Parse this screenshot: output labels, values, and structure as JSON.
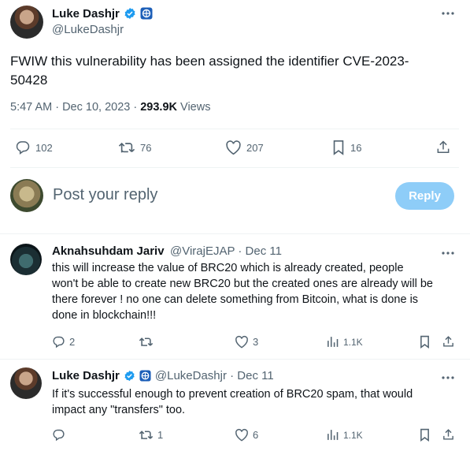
{
  "main_tweet": {
    "author_name": "Luke Dashjr",
    "author_handle": "@LukeDashjr",
    "text_line1": "FWIW this vulnerability has been assigned the identifier CVE-2023-",
    "text_line2": "50428",
    "time": "5:47 AM · Dec 10, 2023 · ",
    "views_count": "293.9K",
    "views_label": " Views",
    "replies": "102",
    "retweets": "76",
    "likes": "207",
    "bookmarks": "16"
  },
  "composer": {
    "placeholder": "Post your reply",
    "reply_button": "Reply"
  },
  "replies": [
    {
      "author_name": "Aknahsuhdam Jariv",
      "author_handle": "@VirajEJAP · Dec 11",
      "lines": [
        "this will increase the value of BRC20 which is already created, people",
        "won't be able to create new BRC20 but the created ones are already will be",
        "there forever ! no one can delete something from Bitcoin, what is done is",
        "done in blockchain!!!"
      ],
      "replies": "2",
      "retweets": "",
      "likes": "3",
      "views": "1.1K"
    },
    {
      "author_name": "Luke Dashjr",
      "author_handle": "@LukeDashjr · Dec 11",
      "lines": [
        "If it's successful enough to prevent creation of BRC20 spam, that would",
        "impact any \"transfers\" too."
      ],
      "replies": "",
      "retweets": "1",
      "likes": "6",
      "views": "1.1K"
    }
  ],
  "colors": {
    "verified_blue": "#1d9bf0",
    "reply_button_bg": "#8ecdf8",
    "text_primary": "#0f1419",
    "text_secondary": "#536471"
  }
}
